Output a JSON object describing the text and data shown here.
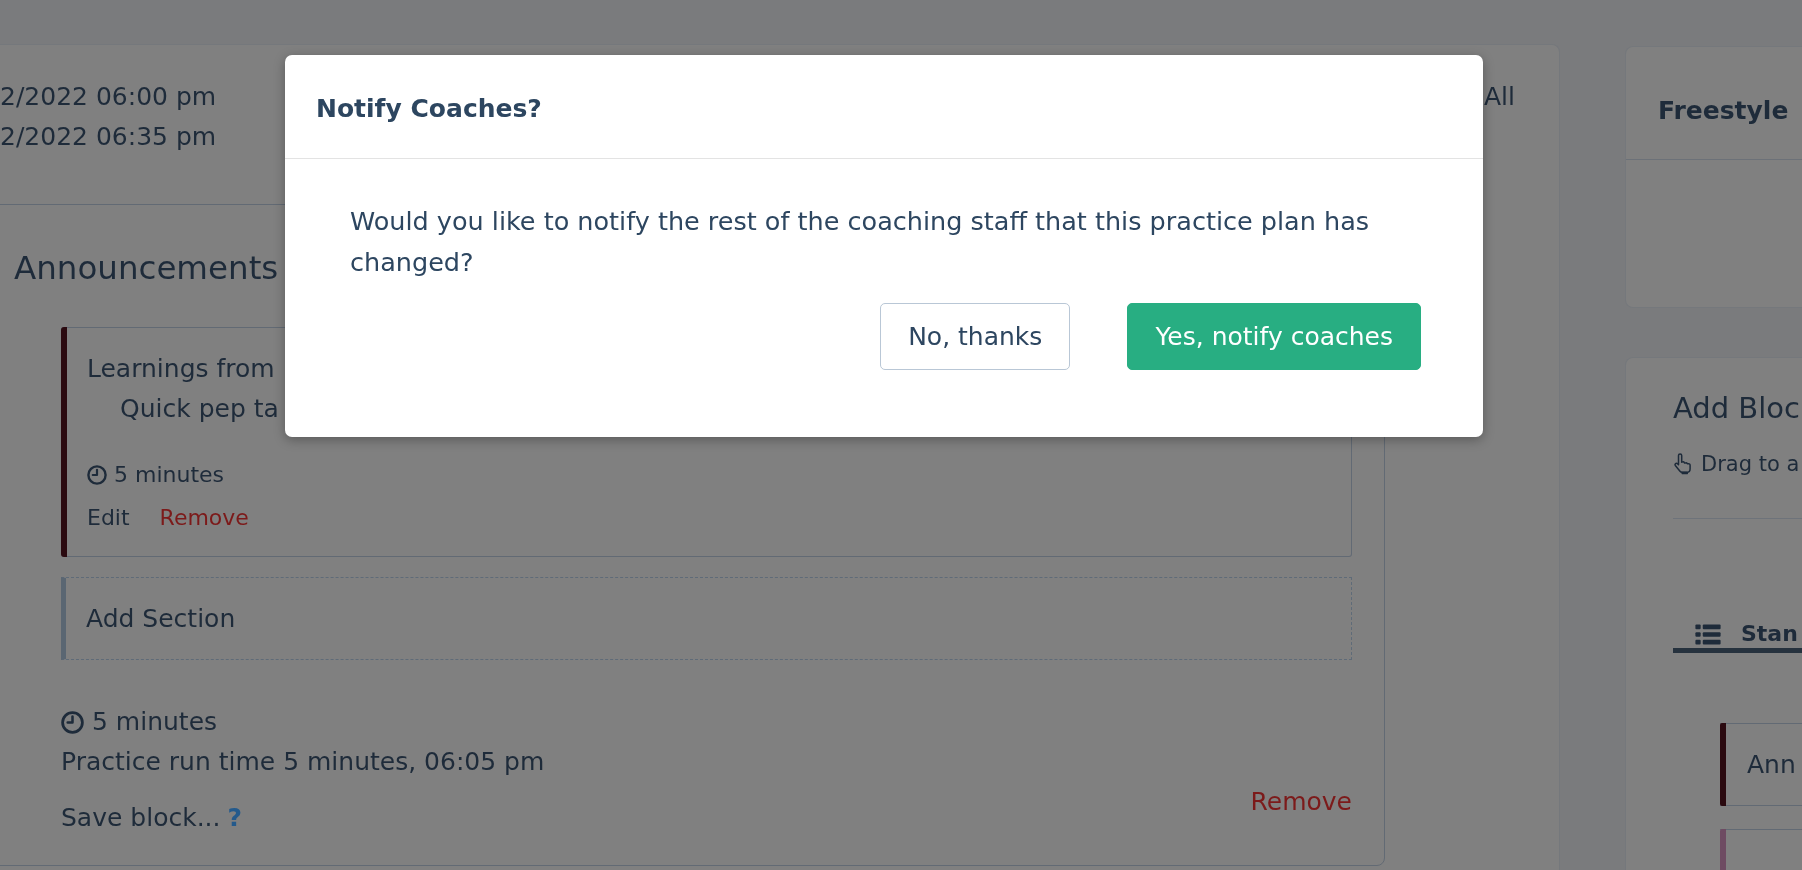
{
  "plan": {
    "start_time": "2/2022 06:00 pm",
    "end_time": "2/2022 06:35 pm",
    "all_link": "All"
  },
  "block": {
    "title": "Announcements",
    "sections": [
      {
        "title": "Learnings from",
        "description": "Quick pep ta",
        "duration": "5 minutes",
        "color": "#2b0a10",
        "actions": [
          {
            "label": "Edit",
            "kind": "edit"
          },
          {
            "label": "Remove",
            "kind": "remove"
          }
        ]
      }
    ],
    "add_section": "Add Section",
    "duration": "5 minutes",
    "run_time": "Practice run time 5 minutes, 06:05 pm",
    "remove": "Remove",
    "save": "Save block...",
    "help": "?"
  },
  "freestyle": {
    "title": "Freestyle"
  },
  "add_block": {
    "title": "Add Bloc",
    "hint": "Drag to a",
    "tabs": [
      {
        "label": "Stan",
        "selected": true
      }
    ],
    "block_types": [
      {
        "label": "Ann",
        "color": "#2b0a10"
      },
      {
        "color": "#6e4b62"
      }
    ]
  },
  "modal": {
    "title": "Notify Coaches?",
    "message": "Would you like to notify the rest of the coaching staff that this practice plan has changed?",
    "buttons": [
      {
        "label": "No, thanks",
        "kind": "secondary"
      },
      {
        "label": "Yes, notify coaches",
        "kind": "primary"
      }
    ]
  }
}
